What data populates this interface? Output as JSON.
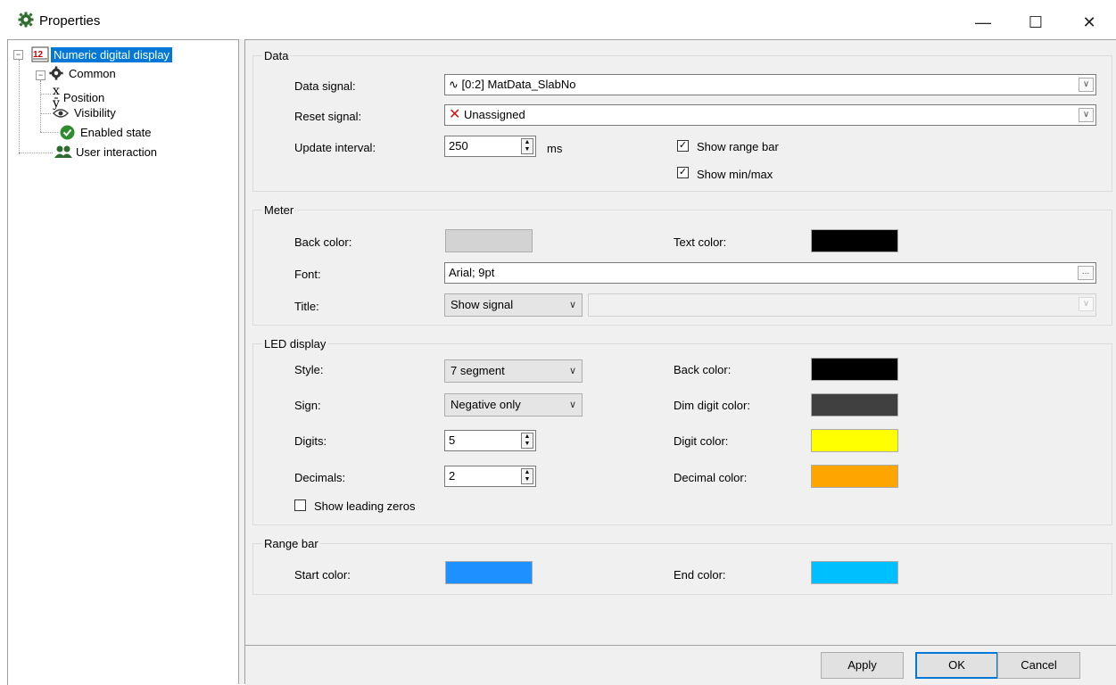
{
  "window": {
    "title": "Properties",
    "minimize_glyph": "—",
    "maximize_glyph": "☐",
    "close_glyph": "✕"
  },
  "tree": {
    "root": {
      "label": "Numeric digital display",
      "icon": "numeric-display-icon"
    },
    "common": {
      "label": "Common",
      "icon": "gear-icon"
    },
    "position": {
      "label": "Position",
      "icon": "xy-icon"
    },
    "visibility": {
      "label": "Visibility",
      "icon": "eye-icon"
    },
    "enabled_state": {
      "label": "Enabled state",
      "icon": "checkmark-circle-icon"
    },
    "user_interaction": {
      "label": "User interaction",
      "icon": "users-icon"
    }
  },
  "data_group": {
    "title": "Data",
    "data_signal_label": "Data signal:",
    "data_signal_value": "[0:2] MatData_SlabNo",
    "reset_signal_label": "Reset signal:",
    "reset_signal_value": "Unassigned",
    "update_interval_label": "Update interval:",
    "update_interval_value": "250",
    "update_interval_unit": "ms",
    "show_range_bar_label": "Show range bar",
    "show_range_bar_checked": true,
    "show_minmax_label": "Show min/max",
    "show_minmax_checked": true
  },
  "meter_group": {
    "title": "Meter",
    "back_color_label": "Back color:",
    "back_color": "#d3d3d3",
    "text_color_label": "Text color:",
    "text_color": "#000000",
    "font_label": "Font:",
    "font_value": "Arial; 9pt",
    "font_button": "...",
    "title_label": "Title:",
    "title_mode": "Show signal",
    "title_text": ""
  },
  "led_group": {
    "title": "LED display",
    "style_label": "Style:",
    "style_value": "7 segment",
    "sign_label": "Sign:",
    "sign_value": "Negative only",
    "digits_label": "Digits:",
    "digits_value": "5",
    "decimals_label": "Decimals:",
    "decimals_value": "2",
    "leading_zeros_label": "Show leading zeros",
    "leading_zeros_checked": false,
    "back_color_label": "Back color:",
    "back_color": "#000000",
    "dim_digit_color_label": "Dim digit color:",
    "dim_digit_color": "#404040",
    "digit_color_label": "Digit color:",
    "digit_color": "#ffff00",
    "decimal_color_label": "Decimal color:",
    "decimal_color": "#ffa500"
  },
  "range_group": {
    "title": "Range bar",
    "start_color_label": "Start color:",
    "start_color": "#1e90ff",
    "end_color_label": "End color:",
    "end_color": "#00bfff"
  },
  "buttons": {
    "apply": "Apply",
    "ok": "OK",
    "cancel": "Cancel"
  }
}
